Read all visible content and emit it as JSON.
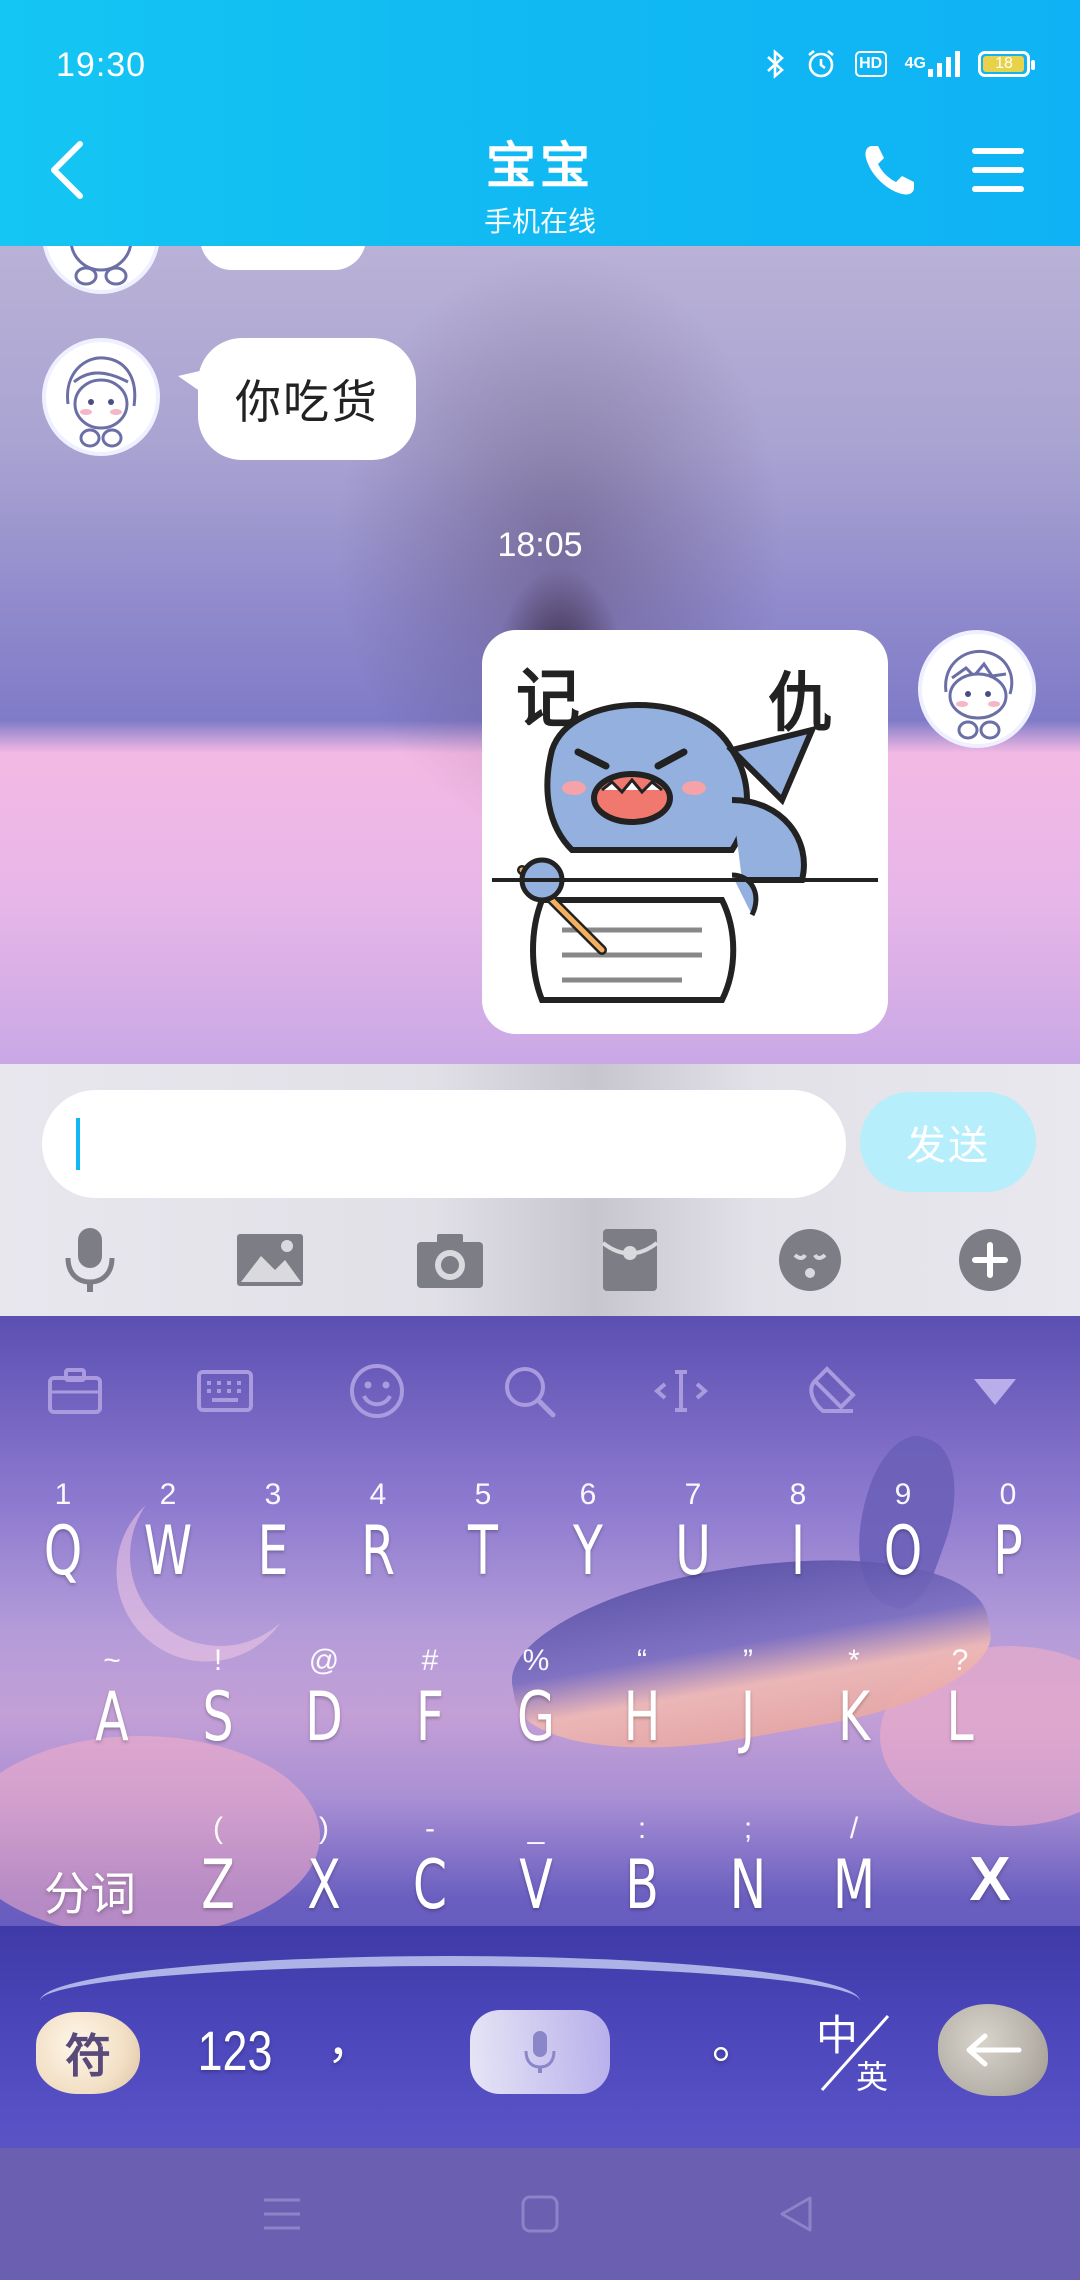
{
  "status_bar": {
    "time": "19:30",
    "hd": "HD",
    "network": "4G",
    "battery": "18",
    "battery_level": 0.18,
    "icons": [
      "bluetooth-icon",
      "alarm-icon",
      "hd-icon",
      "signal-icon",
      "battery-icon"
    ]
  },
  "header": {
    "title": "宝宝",
    "subtitle": "手机在线",
    "back_icon": "chevron-left-icon",
    "call_icon": "phone-icon",
    "menu_icon": "menu-icon"
  },
  "chat": {
    "messages": [
      {
        "side": "left",
        "type": "text",
        "text": "你吃货"
      },
      {
        "side": "right",
        "type": "sticker",
        "sticker_text_left": "记",
        "sticker_text_right": "仇"
      }
    ],
    "time_divider": "18:05"
  },
  "composer": {
    "input_value": "",
    "send_label": "发送",
    "tools": [
      "microphone-icon",
      "image-icon",
      "camera-icon",
      "red-packet-icon",
      "emoji-icon",
      "plus-icon"
    ]
  },
  "keyboard": {
    "toolbar": [
      "briefcase-icon",
      "keyboard-icon",
      "emoji-icon",
      "search-icon",
      "cursor-icon",
      "eraser-icon",
      "collapse-icon"
    ],
    "row1": [
      {
        "main": "Q",
        "sub": "1"
      },
      {
        "main": "W",
        "sub": "2"
      },
      {
        "main": "E",
        "sub": "3"
      },
      {
        "main": "R",
        "sub": "4"
      },
      {
        "main": "T",
        "sub": "5"
      },
      {
        "main": "Y",
        "sub": "6"
      },
      {
        "main": "U",
        "sub": "7"
      },
      {
        "main": "I",
        "sub": "8"
      },
      {
        "main": "O",
        "sub": "9"
      },
      {
        "main": "P",
        "sub": "0"
      }
    ],
    "row2": [
      {
        "main": "A",
        "sub": "~"
      },
      {
        "main": "S",
        "sub": "!"
      },
      {
        "main": "D",
        "sub": "@"
      },
      {
        "main": "F",
        "sub": "#"
      },
      {
        "main": "G",
        "sub": "%"
      },
      {
        "main": "H",
        "sub": "“"
      },
      {
        "main": "J",
        "sub": "”"
      },
      {
        "main": "K",
        "sub": "*"
      },
      {
        "main": "L",
        "sub": "?"
      }
    ],
    "row3": [
      {
        "main": "Z",
        "sub": "("
      },
      {
        "main": "X",
        "sub": ")"
      },
      {
        "main": "C",
        "sub": "-"
      },
      {
        "main": "V",
        "sub": "_"
      },
      {
        "main": "B",
        "sub": ":"
      },
      {
        "main": "N",
        "sub": ";"
      },
      {
        "main": "M",
        "sub": "/"
      }
    ],
    "split_label": "分词",
    "delete_label": "X",
    "symbol_label": "符",
    "numbers_label": "123",
    "comma_label": "，",
    "period_label": "。",
    "lang_top": "中",
    "lang_bottom": "英",
    "enter_icon": "enter-arrow-icon",
    "voice_icon": "microphone-icon"
  },
  "nav_bar": [
    "menu-icon",
    "home-square-icon",
    "back-triangle-icon"
  ]
}
